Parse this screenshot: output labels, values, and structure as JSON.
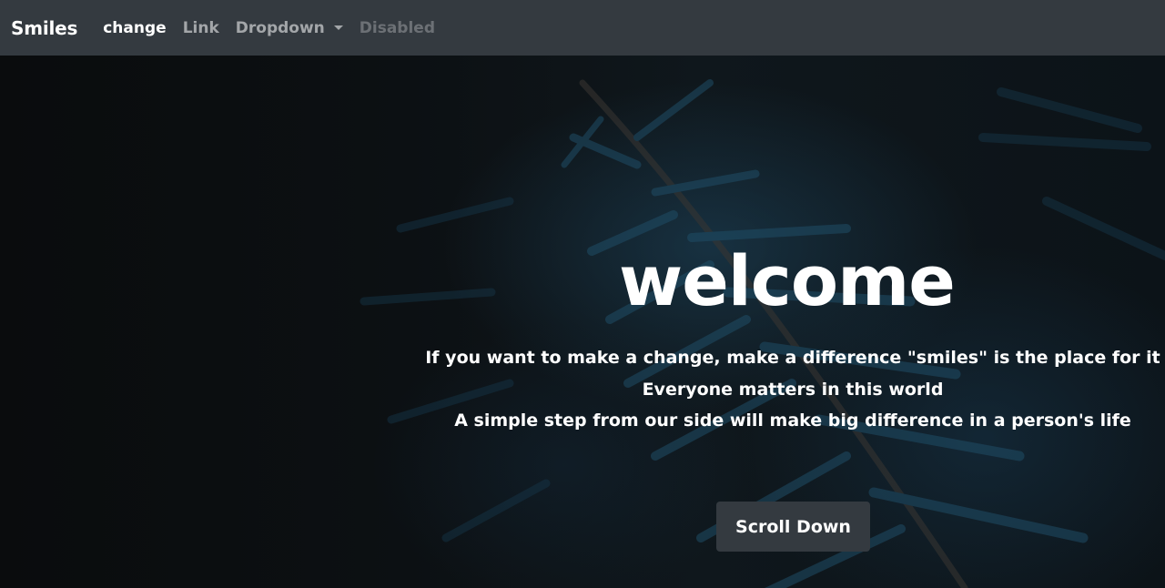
{
  "navbar": {
    "brand": "Smiles",
    "links": [
      {
        "label": "change",
        "state": "active"
      },
      {
        "label": "Link",
        "state": "normal"
      },
      {
        "label": "Dropdown",
        "state": "normal"
      },
      {
        "label": "Disabled",
        "state": "disabled"
      }
    ]
  },
  "hero": {
    "headline": "welcome",
    "lines": [
      "If you want to make a change, make a difference \"smiles\" is the place for it",
      "Everyone matters in this world",
      "A simple step from our side will make big difference in a person's life"
    ],
    "button_label": "Scroll Down"
  },
  "colors": {
    "navbar_bg": "#343a40",
    "hero_bg": "#0b0d0f",
    "foliage": "#1e4a63",
    "button_bg": "#343a40",
    "text": "#ffffff"
  },
  "icons": {
    "dropdown": "caret-down-icon"
  }
}
